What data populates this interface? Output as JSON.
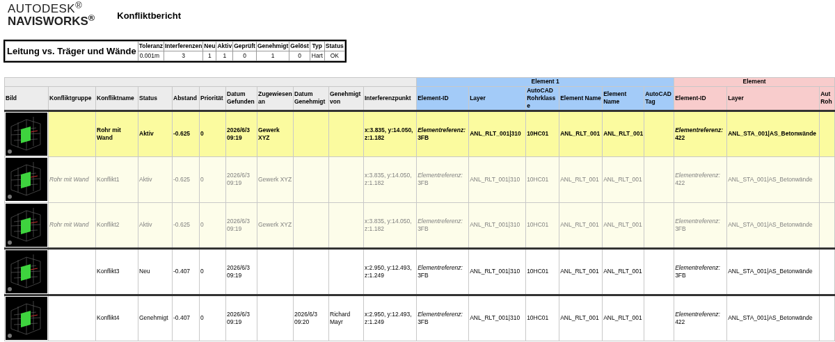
{
  "logo": {
    "line1": "AUTODESK$^{®}$",
    "line2": "NAVISWORKS$^{®}$"
  },
  "title": "Konfliktbericht",
  "summary": {
    "test_name": "Leitung vs. Träger und Wände",
    "columns": [
      "Toleranz",
      "Interferenzen",
      "Neu",
      "Aktiv",
      "Geprüft",
      "Genehmigt",
      "Gelöst",
      "Typ",
      "Status"
    ],
    "values": [
      "0.001m",
      "3",
      "1",
      "1",
      "0",
      "1",
      "0",
      "Hart",
      "OK"
    ]
  },
  "table": {
    "columns": [
      "Bild",
      "Konfliktgruppe",
      "Konfliktname",
      "Status",
      "Abstand",
      "Priorität",
      "Datum Gefunden",
      "Zugewiesen an",
      "Datum Genehmigt",
      "Genehmigt von",
      "Interferenzpunkt"
    ],
    "groups": [
      {
        "label": "Element 1",
        "color": "#a3cbf8",
        "columns": [
          "Element-ID",
          "Layer",
          "AutoCAD Rohrklasse",
          "Element Name",
          "Element Name",
          "AutoCAD Tag"
        ]
      },
      {
        "label": "Element",
        "color": "#f8cccc",
        "columns": [
          "Element-ID",
          "Layer",
          "Aut Roh"
        ]
      }
    ],
    "rows": [
      {
        "kind": "group",
        "conflict_name": "Rohr mit Wand",
        "status": "Aktiv",
        "distance": "-0.625",
        "priority": "0",
        "date_found": "2026/6/3 09:19",
        "assigned_to": "Gewerk XYZ",
        "clash_point": "x:3.835, y:14.050, z:1.182",
        "element1": {
          "element_id": "*Elementreferenz:* 3FB",
          "layer": "ANL_RLT_001|310",
          "pipe_class": "10HC01",
          "name_a": "ANL_RLT_001",
          "name_b": "ANL_RLT_001"
        },
        "element2": {
          "element_id": "*Elementreferenz:* 422",
          "layer": "ANL_STA_001|AS_Betonwände"
        }
      },
      {
        "kind": "member",
        "conflict_group": "Rohr mit Wand",
        "conflict_name": "Konflikt1",
        "status": "Aktiv",
        "distance": "-0.625",
        "priority": "0",
        "date_found": "2026/6/3 09:19",
        "assigned_to": "Gewerk XYZ",
        "clash_point": "x:3.835, y:14.050, z:1.182",
        "element1": {
          "element_id": "*Elementreferenz:* 3FB",
          "layer": "ANL_RLT_001|310",
          "pipe_class": "10HC01",
          "name_a": "ANL_RLT_001",
          "name_b": "ANL_RLT_001"
        },
        "element2": {
          "element_id": "*Elementreferenz:* 422",
          "layer": "ANL_STA_001|AS_Betonwände"
        }
      },
      {
        "kind": "member",
        "conflict_group": "Rohr mit Wand",
        "conflict_name": "Konflikt2",
        "status": "Aktiv",
        "distance": "-0.625",
        "priority": "0",
        "date_found": "2026/6/3 09:19",
        "assigned_to": "Gewerk XYZ",
        "clash_point": "x:3.835, y:14.050, z:1.182",
        "element1": {
          "element_id": "*Elementreferenz:* 3FB",
          "layer": "ANL_RLT_001|310",
          "pipe_class": "10HC01",
          "name_a": "ANL_RLT_001",
          "name_b": "ANL_RLT_001"
        },
        "element2": {
          "element_id": "*Elementreferenz:* 3FB",
          "layer": "ANL_STA_001|AS_Betonwände"
        }
      },
      {
        "kind": "single",
        "conflict_name": "Konflikt3",
        "status": "Neu",
        "distance": "-0.407",
        "priority": "0",
        "date_found": "2026/6/3 09:19",
        "clash_point": "x:2.950, y:12.493, z:1.249",
        "element1": {
          "element_id": "*Elementreferenz:* 3FB",
          "layer": "ANL_RLT_001|310",
          "pipe_class": "10HC01",
          "name_a": "ANL_RLT_001",
          "name_b": "ANL_RLT_001"
        },
        "element2": {
          "element_id": "*Elementreferenz:* 3FB",
          "layer": "ANL_STA_001|AS_Betonwände"
        }
      },
      {
        "kind": "single",
        "conflict_name": "Konflikt4",
        "status": "Genehmigt",
        "distance": "-0.407",
        "priority": "0",
        "date_found": "2026/6/3 09:19",
        "date_approved": "2026/6/3 09:20",
        "approved_by": "Richard Mayr",
        "clash_point": "x:2.950, y:12.493, z:1.249",
        "element1": {
          "element_id": "*Elementreferenz:* 3FB",
          "layer": "ANL_RLT_001|310",
          "pipe_class": "10HC01",
          "name_a": "ANL_RLT_001",
          "name_b": "ANL_RLT_001"
        },
        "element2": {
          "element_id": "*Elementreferenz:* 422",
          "layer": "ANL_STA_001|AS_Betonwände"
        }
      }
    ]
  }
}
